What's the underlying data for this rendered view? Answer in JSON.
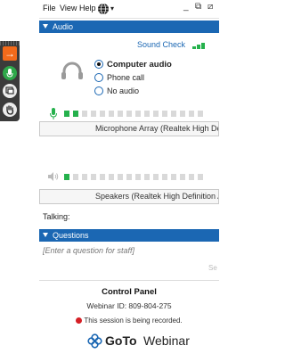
{
  "menu": {
    "file": "File",
    "view": "View",
    "help": "Help",
    "caret": "▾"
  },
  "window": {
    "minimize": "_",
    "restore": "⧉",
    "maximize": "⧄"
  },
  "audio": {
    "section_title": "Audio",
    "sound_check": "Sound Check",
    "options": [
      "Computer audio",
      "Phone call",
      "No audio"
    ],
    "selected_index": 0,
    "mic_level_fraction": 0.12,
    "speaker_level_fraction": 0.06,
    "microphone_device": "Microphone Array (Realtek High Defi...",
    "speaker_device": "Speakers (Realtek High Definition Au...",
    "talking_label": "Talking:"
  },
  "questions": {
    "section_title": "Questions",
    "placeholder": "[Enter a question for staff]",
    "send_label": "Se"
  },
  "footer": {
    "control_panel": "Control Panel",
    "webinar_id": "Webinar ID: 809-804-275",
    "recorded": "This session is being recorded.",
    "brand_goto_go": "Go",
    "brand_goto_to": "To",
    "brand_webinar": "Webinar"
  },
  "colors": {
    "accent": "#1b67b3",
    "green": "#25b14c",
    "orange": "#f26a1b",
    "record": "#d51f25"
  }
}
